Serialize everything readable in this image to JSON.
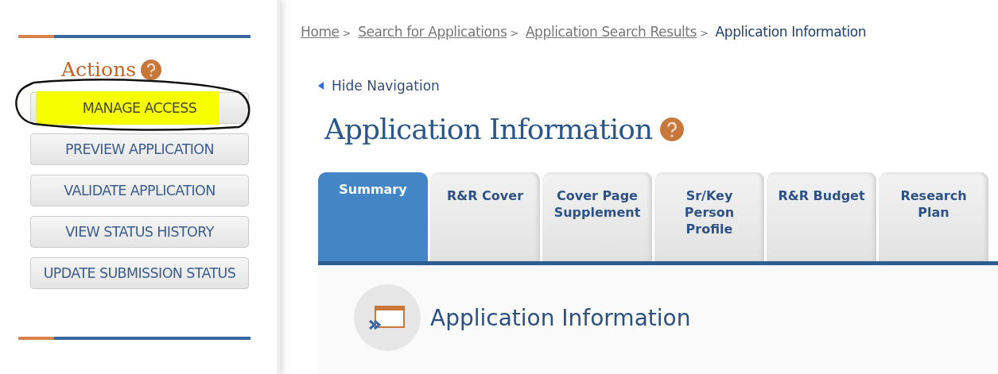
{
  "sidebar": {
    "title": "Actions",
    "actions": [
      {
        "label": "MANAGE ACCESS",
        "highlighted": true,
        "circled": true
      },
      {
        "label": "PREVIEW APPLICATION",
        "highlighted": false,
        "circled": false
      },
      {
        "label": "VALIDATE APPLICATION",
        "highlighted": false,
        "circled": false
      },
      {
        "label": "VIEW STATUS HISTORY",
        "highlighted": false,
        "circled": false
      },
      {
        "label": "UPDATE SUBMISSION STATUS",
        "highlighted": false,
        "circled": false
      }
    ]
  },
  "breadcrumb": [
    {
      "label": "Home",
      "link": true
    },
    {
      "label": "Search for Applications",
      "link": true
    },
    {
      "label": "Application Search Results",
      "link": true
    },
    {
      "label": "Application Information",
      "link": false
    }
  ],
  "breadcrumb_separator": ">",
  "hide_navigation": "Hide Navigation",
  "page_title": "Application Information",
  "tabs": [
    {
      "label": "Summary",
      "selected": true
    },
    {
      "label": "R&R Cover",
      "selected": false
    },
    {
      "label": "Cover Page Supplement",
      "selected": false
    },
    {
      "label": "Sr/Key Person Profile",
      "selected": false
    },
    {
      "label": "R&R Budget",
      "selected": false
    },
    {
      "label": "Research Plan",
      "selected": false
    }
  ],
  "section_heading": "Application Information"
}
